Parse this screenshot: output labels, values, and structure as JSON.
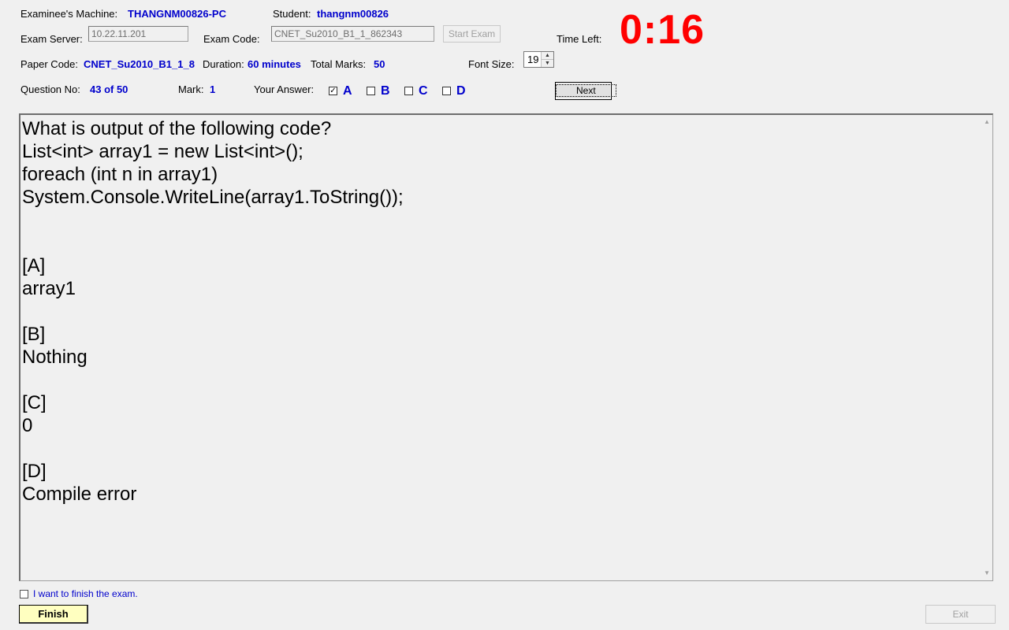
{
  "header": {
    "machine_label": "Examinee's Machine:",
    "machine_value": "THANGNM00826-PC",
    "student_label": "Student:",
    "student_value": "thangnm00826",
    "server_label": "Exam Server:",
    "server_value": "10.22.11.201",
    "exam_code_label": "Exam Code:",
    "exam_code_value": "CNET_Su2010_B1_1_862343",
    "start_exam_label": "Start Exam",
    "time_left_label": "Time Left:",
    "time_left_value": "0:16",
    "paper_code_label": "Paper Code:",
    "paper_code_value": "CNET_Su2010_B1_1_8",
    "duration_label": "Duration:",
    "duration_value": "60 minutes",
    "total_marks_label": "Total Marks:",
    "total_marks_value": "50",
    "font_size_label": "Font Size:",
    "font_size_value": "19",
    "question_no_label": "Question No:",
    "question_no_value": "43 of 50",
    "mark_label": "Mark:",
    "mark_value": "1",
    "your_answer_label": "Your Answer:",
    "next_label": "Next"
  },
  "answers": [
    {
      "letter": "A",
      "checked": true
    },
    {
      "letter": "B",
      "checked": false
    },
    {
      "letter": "C",
      "checked": false
    },
    {
      "letter": "D",
      "checked": false
    }
  ],
  "question": {
    "text": "What is output of the following code?\nList<int> array1 = new List<int>();\nforeach (int n in array1)\nSystem.Console.WriteLine(array1.ToString());\n\n\n[A]\narray1\n\n[B]\nNothing\n\n[C]\n0\n\n[D]\nCompile error"
  },
  "footer": {
    "finish_checkbox_label": "I want to finish the exam.",
    "finish_button_label": "Finish",
    "exit_button_label": "Exit"
  },
  "colors": {
    "accent_blue": "#0000cc",
    "timer_red": "#ff0000",
    "finish_bg": "#ffffc0",
    "window_bg": "#f0f0f0"
  },
  "icons": {
    "check": "check-icon",
    "spin_up": "spin-up-icon",
    "spin_down": "spin-down-icon",
    "scroll_up": "scroll-up-icon",
    "scroll_down": "scroll-down-icon"
  }
}
